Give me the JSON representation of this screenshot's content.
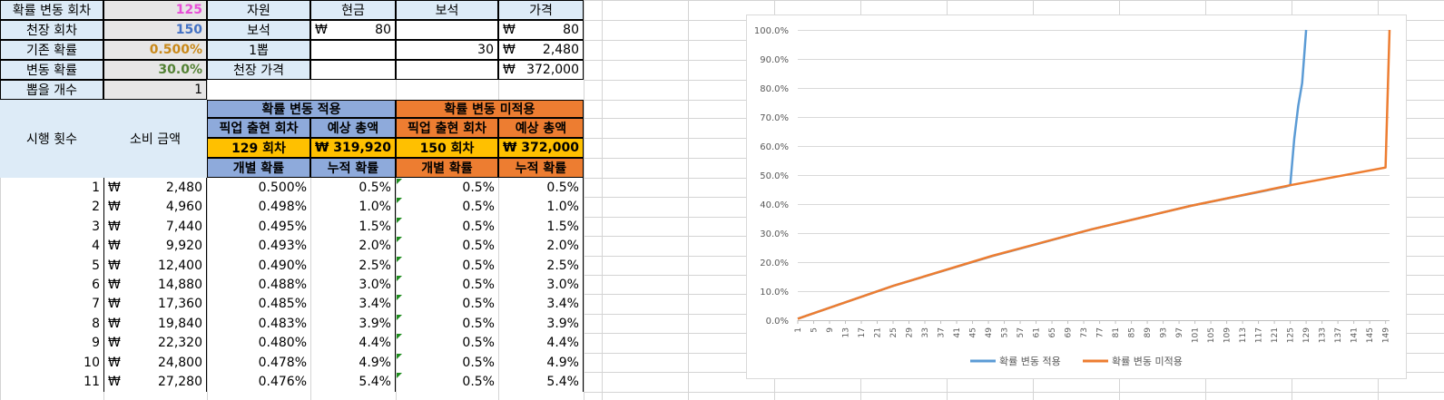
{
  "params": [
    {
      "label": "확률 변동 회차",
      "value": "125",
      "color": "#e84ed7"
    },
    {
      "label": "천장 회차",
      "value": "150",
      "color": "#4472c4"
    },
    {
      "label": "기존 확률",
      "value": "0.500%",
      "color": "#c9891a"
    },
    {
      "label": "변동 확률",
      "value": "30.0%",
      "color": "#548235"
    },
    {
      "label": "뽑을 개수",
      "value": "1",
      "color": "#000000"
    }
  ],
  "resource_table": {
    "headers": [
      "자원",
      "현금",
      "보석",
      "가격"
    ],
    "rows": [
      {
        "name": "보석",
        "cash": "₩",
        "cash_amt": "80",
        "gem": "",
        "price": "₩",
        "price_amt": "80"
      },
      {
        "name": "1뽑",
        "cash": "",
        "cash_amt": "",
        "gem": "30",
        "price": "₩",
        "price_amt": "2,480"
      },
      {
        "name": "천장 가격",
        "cash": "",
        "cash_amt": "",
        "gem": "",
        "price": "₩",
        "price_amt": "372,000"
      }
    ]
  },
  "sim": {
    "col_trials": "시행 횟수",
    "col_spent": "소비 금액",
    "applied": {
      "title": "확률 변동 적용",
      "pickup_label": "픽업 출현 회차",
      "total_label": "예상 총액",
      "pickup": "129 회차",
      "total": "₩ 319,920",
      "indiv": "개별 확률",
      "cumul": "누적 확률"
    },
    "not_applied": {
      "title": "확률 변동 미적용",
      "pickup_label": "픽업 출현 회차",
      "total_label": "예상 총액",
      "pickup": "150 회차",
      "total": "₩ 372,000",
      "indiv": "개별 확률",
      "cumul": "누적 확률"
    },
    "currency": "₩",
    "rows": [
      {
        "n": "1",
        "amt": "2,480",
        "p1": "0.500%",
        "c1": "0.5%",
        "p2": "0.5%",
        "c2": "0.5%"
      },
      {
        "n": "2",
        "amt": "4,960",
        "p1": "0.498%",
        "c1": "1.0%",
        "p2": "0.5%",
        "c2": "1.0%"
      },
      {
        "n": "3",
        "amt": "7,440",
        "p1": "0.495%",
        "c1": "1.5%",
        "p2": "0.5%",
        "c2": "1.5%"
      },
      {
        "n": "4",
        "amt": "9,920",
        "p1": "0.493%",
        "c1": "2.0%",
        "p2": "0.5%",
        "c2": "2.0%"
      },
      {
        "n": "5",
        "amt": "12,400",
        "p1": "0.490%",
        "c1": "2.5%",
        "p2": "0.5%",
        "c2": "2.5%"
      },
      {
        "n": "6",
        "amt": "14,880",
        "p1": "0.488%",
        "c1": "3.0%",
        "p2": "0.5%",
        "c2": "3.0%"
      },
      {
        "n": "7",
        "amt": "17,360",
        "p1": "0.485%",
        "c1": "3.4%",
        "p2": "0.5%",
        "c2": "3.4%"
      },
      {
        "n": "8",
        "amt": "19,840",
        "p1": "0.483%",
        "c1": "3.9%",
        "p2": "0.5%",
        "c2": "3.9%"
      },
      {
        "n": "9",
        "amt": "22,320",
        "p1": "0.480%",
        "c1": "4.4%",
        "p2": "0.5%",
        "c2": "4.4%"
      },
      {
        "n": "10",
        "amt": "24,800",
        "p1": "0.478%",
        "c1": "4.9%",
        "p2": "0.5%",
        "c2": "4.9%"
      },
      {
        "n": "11",
        "amt": "27,280",
        "p1": "0.476%",
        "c1": "5.4%",
        "p2": "0.5%",
        "c2": "5.4%"
      }
    ]
  },
  "chart_data": {
    "type": "line",
    "title": "",
    "xlabel": "",
    "ylabel": "",
    "ylim": [
      0,
      100
    ],
    "yticks": [
      "0.0%",
      "10.0%",
      "20.0%",
      "30.0%",
      "40.0%",
      "50.0%",
      "60.0%",
      "70.0%",
      "80.0%",
      "90.0%",
      "100.0%"
    ],
    "xticks": [
      "1",
      "5",
      "9",
      "13",
      "17",
      "21",
      "25",
      "29",
      "33",
      "37",
      "41",
      "45",
      "49",
      "53",
      "57",
      "61",
      "65",
      "69",
      "73",
      "77",
      "81",
      "85",
      "89",
      "93",
      "97",
      "101",
      "105",
      "109",
      "113",
      "117",
      "121",
      "125",
      "129",
      "133",
      "137",
      "141",
      "145",
      "149"
    ],
    "grid": true,
    "legend_position": "bottom",
    "series": [
      {
        "name": "확률 변동 적용",
        "color": "#5b9bd5",
        "points": [
          [
            1,
            0.5
          ],
          [
            25,
            11.8
          ],
          [
            50,
            22.1
          ],
          [
            75,
            31.3
          ],
          [
            100,
            39.4
          ],
          [
            124,
            46.1
          ],
          [
            125,
            46.5
          ],
          [
            126,
            62.5
          ],
          [
            127,
            73.8
          ],
          [
            128,
            81.7
          ],
          [
            129,
            100
          ]
        ]
      },
      {
        "name": "확률 변동 미적용",
        "color": "#ed7d31",
        "points": [
          [
            1,
            0.5
          ],
          [
            25,
            11.8
          ],
          [
            50,
            22.2
          ],
          [
            75,
            31.3
          ],
          [
            100,
            39.4
          ],
          [
            125,
            46.5
          ],
          [
            149,
            52.6
          ],
          [
            150,
            100
          ]
        ]
      }
    ]
  }
}
